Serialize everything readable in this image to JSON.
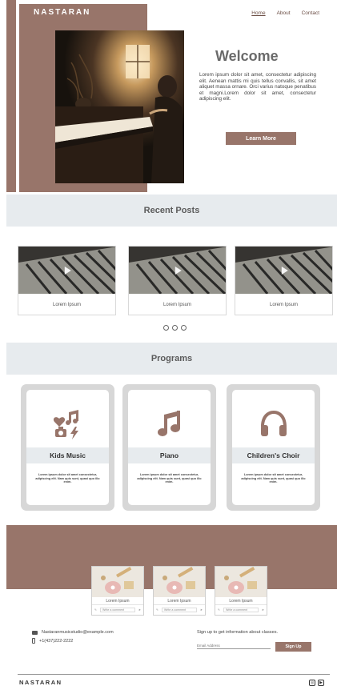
{
  "header": {
    "logo": "NASTARAN",
    "nav": [
      "Home",
      "About",
      "Contact"
    ]
  },
  "hero": {
    "title": "Welcome",
    "body": "Lorem ipsum dolor sit amet, consectetur adipiscing elit. Aenean mattis mi quis tellus convallis, sit amet aliquet massa ornare. Orci varius natoque penatibus et magni.Lorem dolor sit amet, consectetur adipiscing elit.",
    "button": "Learn More"
  },
  "recent_posts": {
    "heading": "Recent Posts",
    "items": [
      {
        "label": "Lorem Ipsum"
      },
      {
        "label": "Lorem Ipsum"
      },
      {
        "label": "Lorem Ipsum"
      }
    ]
  },
  "programs": {
    "heading": "Programs",
    "items": [
      {
        "title": "Kids Music",
        "icon": "kids-music-icon",
        "desc": "Lorem ipsum dolor sit amet consectetur, adipiscing elit. Nam quis sunt, quasi quo illo enim."
      },
      {
        "title": "Piano",
        "icon": "music-note-icon",
        "desc": "Lorem ipsum dolor sit amet consectetur, adipiscing elit. Nam quis sunt, quasi quo illo enim."
      },
      {
        "title": "Children's Choir",
        "icon": "headphones-icon",
        "desc": "Lorem ipsum dolor sit amet consectetur, adipiscing elit. Nam quis sunt, quasi quo illo enim."
      }
    ]
  },
  "gallery": {
    "items": [
      {
        "label": "Lorem Ipsum",
        "comment_placeholder": "Write a comment"
      },
      {
        "label": "Lorem Ipsum",
        "comment_placeholder": "Write a comment"
      },
      {
        "label": "Lorem Ipsum",
        "comment_placeholder": "Write a comment"
      }
    ]
  },
  "contact": {
    "email": "Nastaranmusicstudio@example.com",
    "phone": "+1(437)222-2222",
    "signup_text": "Sign up to get information about classes.",
    "email_placeholder": "Email Address",
    "signup_button": "Sign Up"
  },
  "footer": {
    "logo": "NASTARAN",
    "social": [
      "instagram-icon",
      "youtube-icon"
    ]
  },
  "colors": {
    "brand": "#98756a",
    "band": "#e7ebee",
    "card_border": "#d7d7d7"
  }
}
